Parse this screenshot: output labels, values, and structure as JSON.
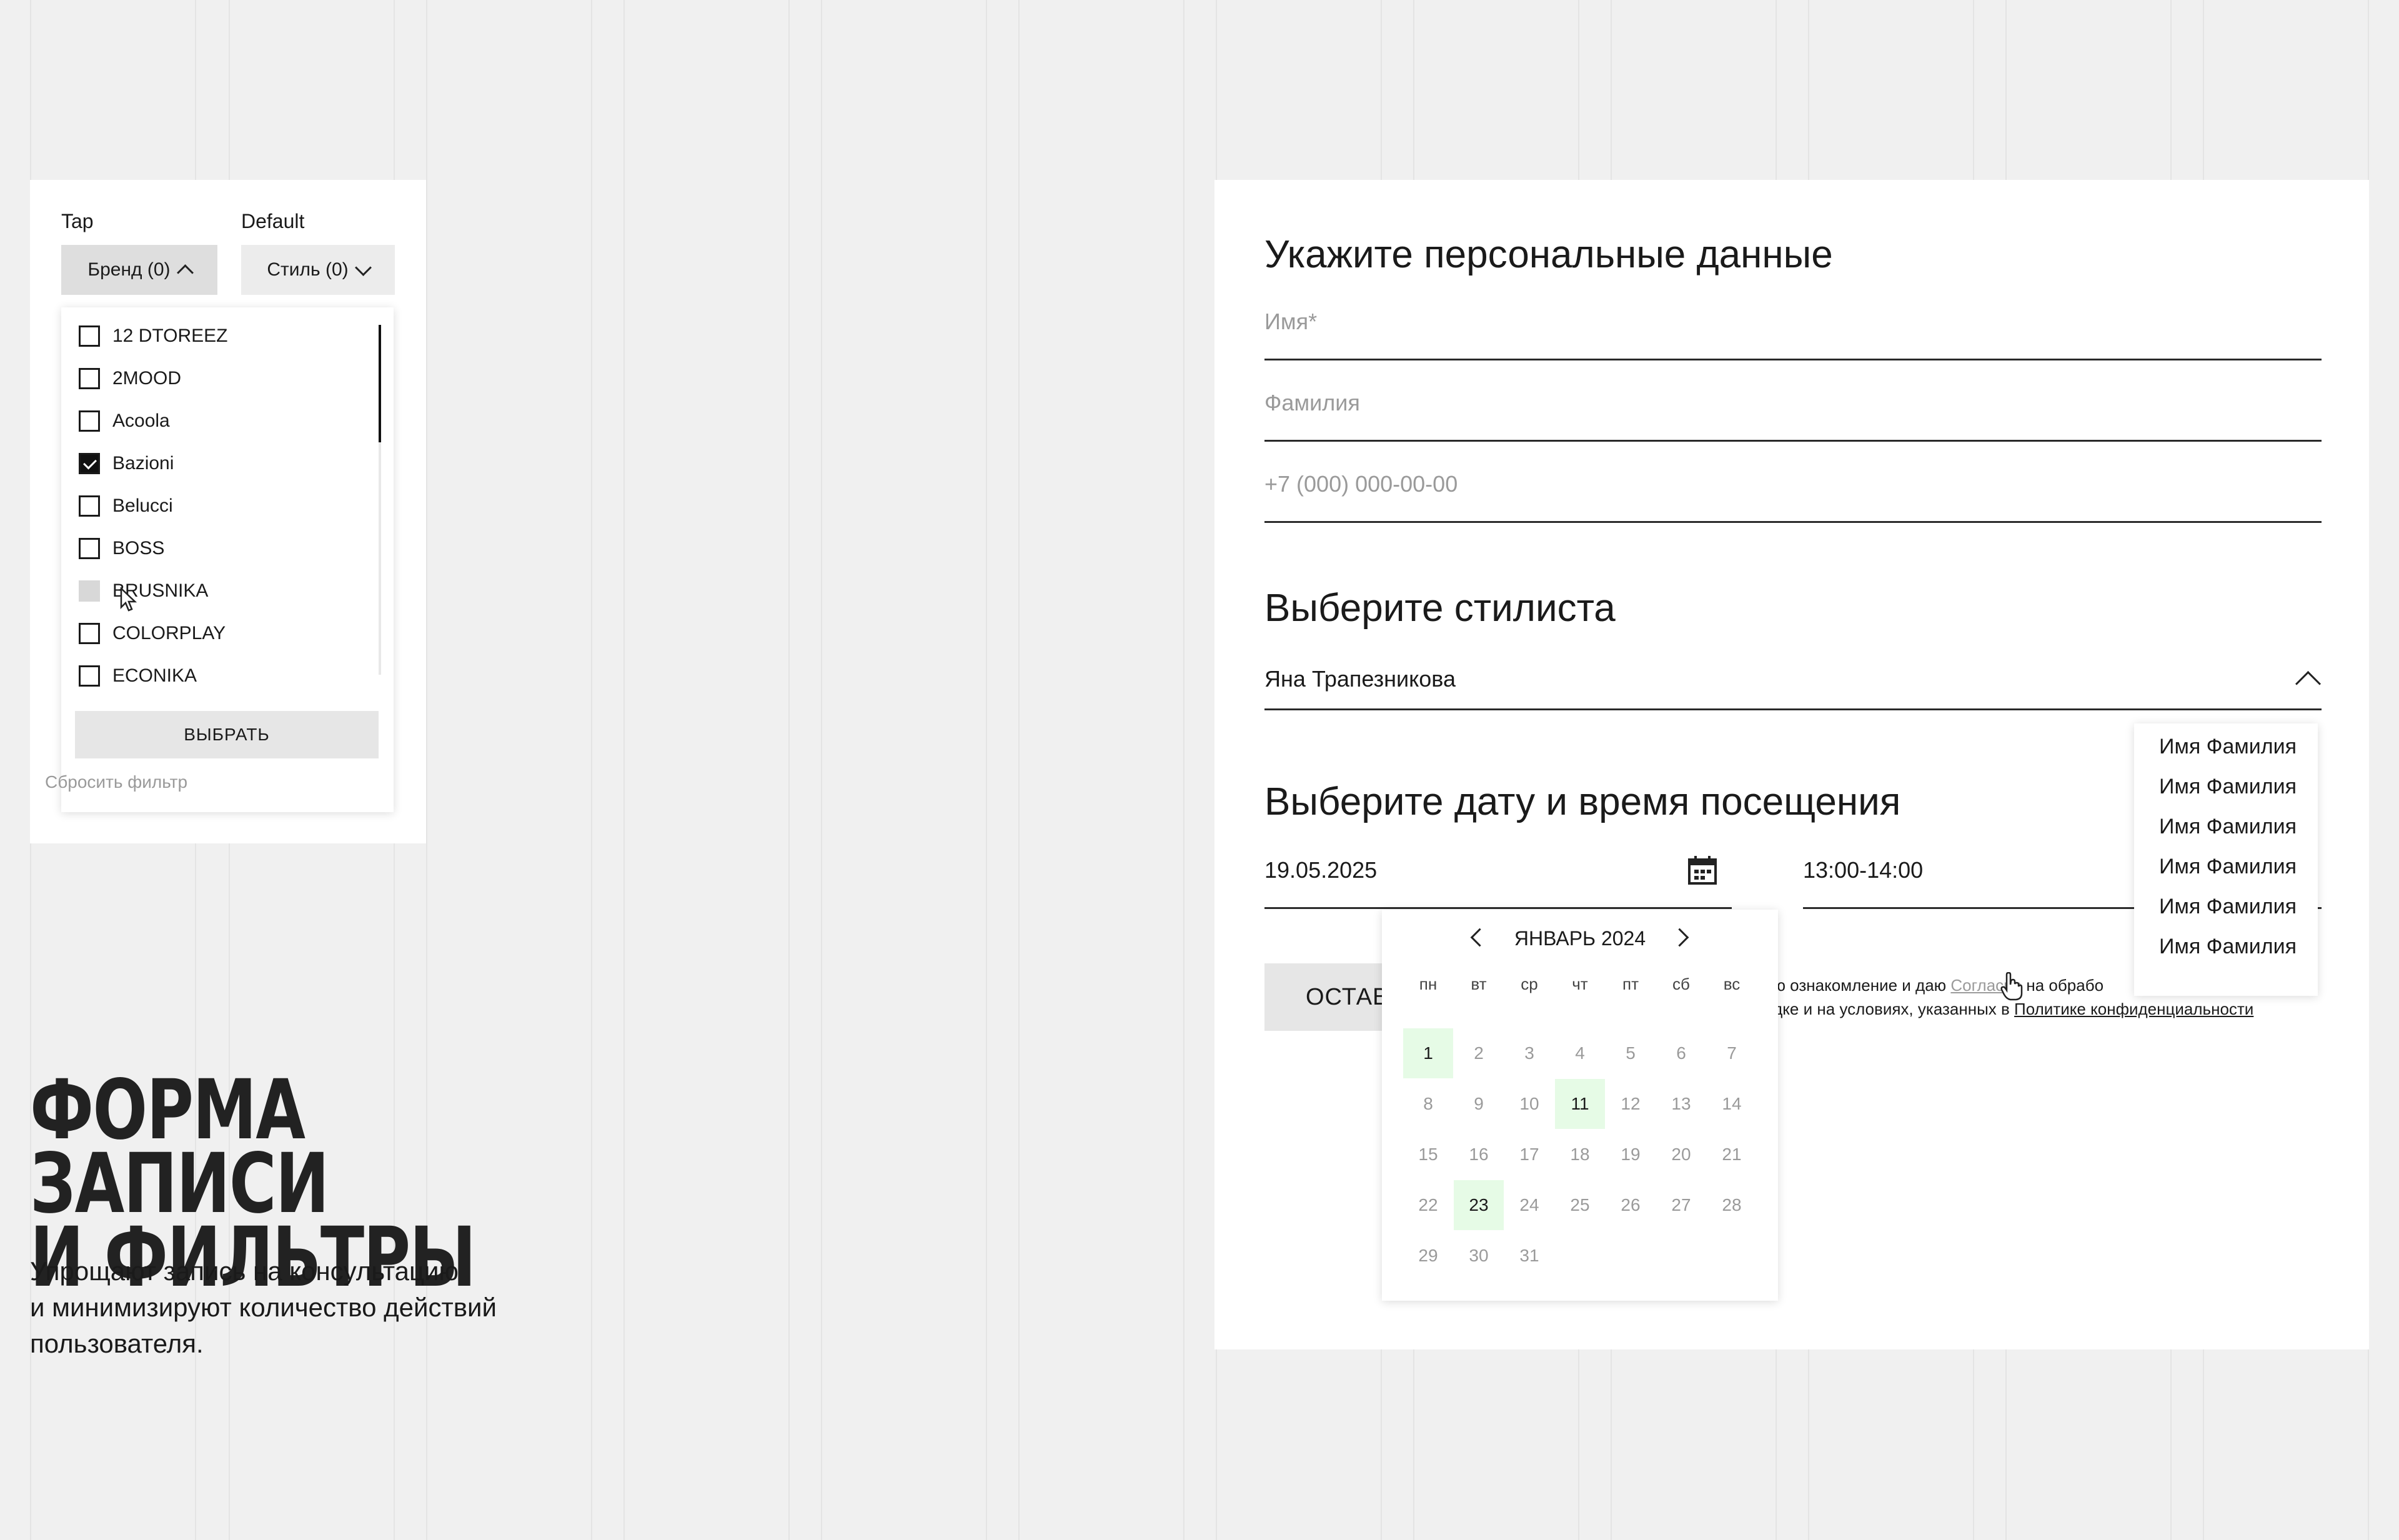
{
  "filter": {
    "tap_label": "Tap",
    "default_label": "Default",
    "brand_button": "Бренд (0)",
    "style_button": "Стиль (0)",
    "brands": [
      {
        "label": "12 DTOREEZ",
        "state": "unchecked"
      },
      {
        "label": "2MOOD",
        "state": "unchecked"
      },
      {
        "label": "Acoola",
        "state": "unchecked"
      },
      {
        "label": "Bazioni",
        "state": "checked"
      },
      {
        "label": "Belucci",
        "state": "unchecked"
      },
      {
        "label": "BOSS",
        "state": "unchecked"
      },
      {
        "label": "BRUSNIKA",
        "state": "hover"
      },
      {
        "label": "COLORPLAY",
        "state": "unchecked"
      },
      {
        "label": "ECONIKA",
        "state": "unchecked"
      }
    ],
    "apply_button": "ВЫБРАТЬ",
    "reset_link": "Сбросить фильтр"
  },
  "intro": {
    "title_line1": "ФОРМА ЗАПИСИ",
    "title_line2": "И ФИЛЬТРЫ",
    "subtitle_line1": "Упрощают запись на консультацию",
    "subtitle_line2": "и минимизируют количество действий",
    "subtitle_line3": "пользователя."
  },
  "form": {
    "personal_heading": "Укажите персональные данные",
    "name_placeholder": "Имя*",
    "surname_placeholder": "Фамилия",
    "phone_placeholder": "+7 (000) 000-00-00",
    "stylist_heading": "Выберите стилиста",
    "stylist_value": "Яна Трапезникова",
    "stylist_options": [
      "Имя Фамилия",
      "Имя Фамилия",
      "Имя Фамилия",
      "Имя Фамилия",
      "Имя Фамилия",
      "Имя Фамилия"
    ],
    "date_heading": "Выберите дату и время посещения",
    "date_value": "19.05.2025",
    "time_value": "13:00-14:00",
    "submit_button": "ОСТАВИТЬ",
    "consent_part1": "аю ознакомление и даю ",
    "consent_link1": "Согласие",
    "consent_part2": " на обрабо",
    "consent_part3": "ядке и на условиях, указанных в ",
    "consent_link2": "Политике конфиденциальности"
  },
  "calendar": {
    "month_label": "ЯНВАРЬ 2024",
    "weekdays": [
      "пн",
      "вт",
      "ср",
      "чт",
      "пт",
      "сб",
      "вс"
    ],
    "days": [
      "1",
      "2",
      "3",
      "4",
      "5",
      "6",
      "7",
      "8",
      "9",
      "10",
      "11",
      "12",
      "13",
      "14",
      "15",
      "16",
      "17",
      "18",
      "19",
      "20",
      "21",
      "22",
      "23",
      "24",
      "25",
      "26",
      "27",
      "28",
      "29",
      "30",
      "31"
    ],
    "highlighted": [
      "1",
      "11",
      "23"
    ],
    "highlight_color": "#e6fbe6"
  }
}
